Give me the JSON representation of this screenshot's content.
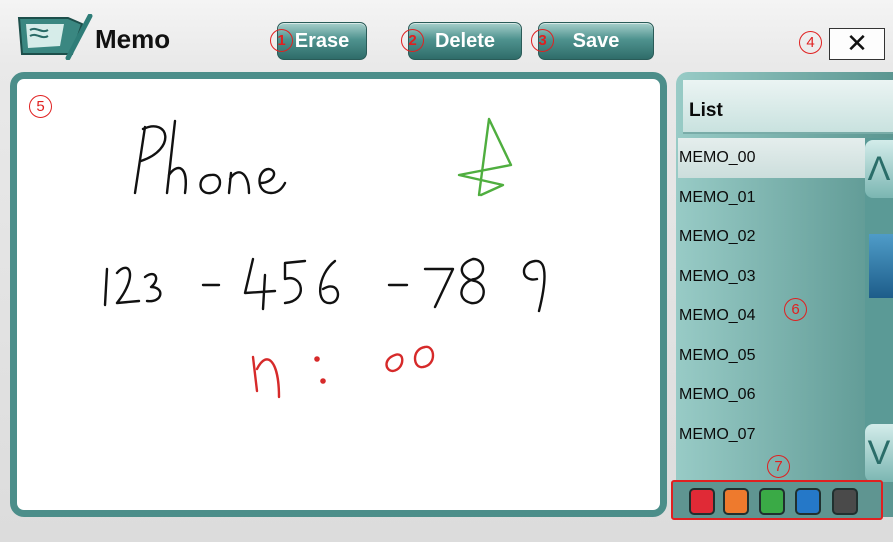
{
  "app": {
    "title": "Memo",
    "icon": "memo-notepad-icon"
  },
  "toolbar": {
    "erase": {
      "label": "Erase",
      "badge": "1"
    },
    "delete": {
      "label": "Delete",
      "badge": "2"
    },
    "save": {
      "label": "Save",
      "badge": "3"
    },
    "close": {
      "label": "✕",
      "badge": "4"
    }
  },
  "canvas": {
    "badge": "5",
    "strokes": {
      "line1": "Phone",
      "line2": "123 - 456 - 789",
      "line3": "11:00"
    }
  },
  "list": {
    "title": "List",
    "badge": "6",
    "items": [
      "MEMO_00",
      "MEMO_01",
      "MEMO_02",
      "MEMO_03",
      "MEMO_04",
      "MEMO_05",
      "MEMO_06",
      "MEMO_07"
    ],
    "selected_index": 0,
    "scroll_up": "Λ",
    "scroll_down": "V"
  },
  "palette": {
    "badge": "7",
    "colors": [
      "#e02a36",
      "#ee7a2d",
      "#3aaa46",
      "#2578c8",
      "#4a4a4a"
    ]
  }
}
